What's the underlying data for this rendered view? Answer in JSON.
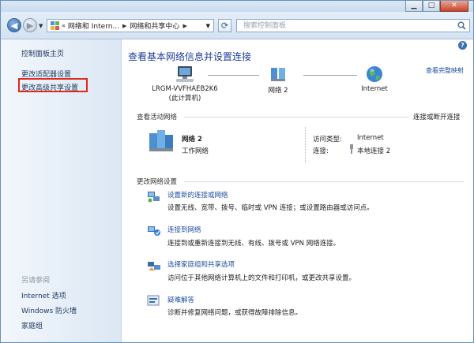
{
  "window": {
    "minimize_glyph": "▁",
    "maximize_glyph": "□",
    "close_glyph": "✕"
  },
  "address": {
    "crumbs": [
      "网络和 Intern...",
      "网络和共享中心"
    ],
    "more_glyph": "«",
    "search_placeholder": "搜索控制面板"
  },
  "sidebar": {
    "items": [
      {
        "label": "控制面板主页"
      },
      {
        "label": "更改适配器设置"
      },
      {
        "label": "更改高级共享设置"
      }
    ],
    "see_also_heading": "另请参阅",
    "see_also": [
      {
        "label": "Internet 选项"
      },
      {
        "label": "Windows 防火墙"
      },
      {
        "label": "家庭组"
      }
    ]
  },
  "main": {
    "title": "查看基本网络信息并设置连接",
    "full_map_link": "查看完整映射",
    "map": {
      "computer_name": "LRGM-VVFHAEB2K6",
      "computer_sub": "(此计算机)",
      "network_name": "网络  2",
      "internet": "Internet"
    },
    "active_section": {
      "heading": "查看活动网络",
      "connect_link": "连接或断开连接",
      "network_name": "网络  2",
      "network_type": "工作网络",
      "access_type_label": "访问类型:",
      "access_type_value": "Internet",
      "connection_label": "连接:",
      "connection_value": "本地连接 2"
    },
    "change_section": {
      "heading": "更改网络设置",
      "tasks": [
        {
          "title": "设置新的连接或网络",
          "desc": "设置无线、宽带、拨号、临时或 VPN 连接；或设置路由器或访问点。"
        },
        {
          "title": "连接到网络",
          "desc": "连接到或重新连接到无线、有线、拨号或 VPN 网络连接。"
        },
        {
          "title": "选择家庭组和共享选项",
          "desc": "访问位于其他网络计算机上的文件和打印机，或更改共享设置。"
        },
        {
          "title": "疑难解答",
          "desc": "诊断并修复网络问题，或获得故障排除信息。"
        }
      ]
    }
  },
  "colors": {
    "title_blue": "#1e3c9a",
    "link_blue": "#1e4fa0",
    "highlight_red": "#e0281e"
  }
}
